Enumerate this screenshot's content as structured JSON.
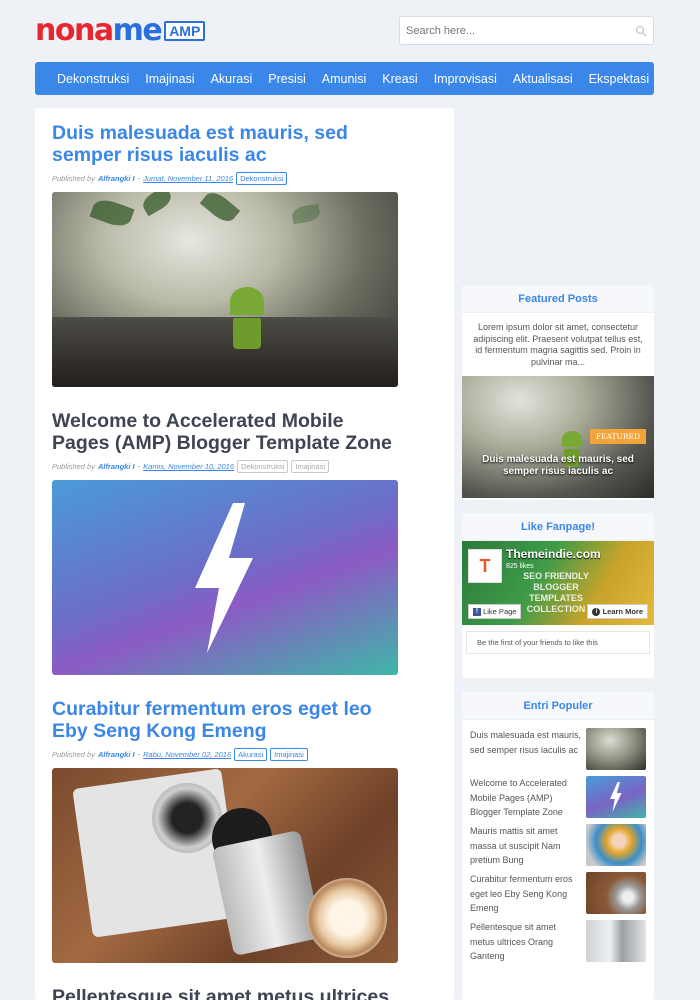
{
  "header": {
    "logo_part1": "nona",
    "logo_part2": "me",
    "logo_badge": "AMP",
    "search_placeholder": "Search here..."
  },
  "nav": {
    "items": [
      "Dekonstruksi",
      "Imajinasi",
      "Akurasi",
      "Presisi",
      "Amunisi",
      "Kreasi",
      "Improvisasi",
      "Aktualisasi",
      "Ekspektasi"
    ]
  },
  "posts": [
    {
      "title": "Duis malesuada est mauris, sed semper risus iaculis ac",
      "published_by": "Published by",
      "author": "Alfrangki I",
      "sep": "-",
      "date": "Jumat, November 11, 2016",
      "labels": [
        "Dekonstruksi"
      ]
    },
    {
      "title": "Welcome to Accelerated Mobile Pages (AMP) Blogger Template Zone",
      "published_by": "Published by",
      "author": "Alfrangki I",
      "sep": "-",
      "date": "Kamis, November 10, 2016",
      "labels": [
        "Dekonstruksi",
        "Imajinasi"
      ]
    },
    {
      "title": "Curabitur fermentum eros eget leo Eby Seng Kong Emeng",
      "published_by": "Published by",
      "author": "Alfrangki I",
      "sep": "-",
      "date": "Rabu, November 02, 2016",
      "labels": [
        "Akurasi",
        "Imajinasi"
      ]
    },
    {
      "title": "Pellentesque sit amet metus ultrices"
    }
  ],
  "sidebar": {
    "featured": {
      "title": "Featured Posts",
      "excerpt": "Lorem ipsum dolor sit amet, consectetur adipiscing elit. Praesent volutpat tellus est, id fermentum magna sagittis sed. Proin in pulvinar ma...",
      "badge": "FEATURED",
      "caption": "Duis malesuada est mauris, sed semper risus iaculis ac"
    },
    "fanpage": {
      "title": "Like Fanpage!",
      "page_name": "Themeindie.com",
      "likes": "825 likes",
      "banner_text": "SEO FRIENDLY BLOGGER TEMPLATES COLLECTION",
      "like_button": "Like Page",
      "learn_button": "Learn More",
      "friends_text": "Be the first of your friends to like this"
    },
    "popular": {
      "title": "Entri Populer",
      "items": [
        "Duis malesuada est mauris, sed semper risus iaculis ac",
        "Welcome to Accelerated Mobile Pages (AMP) Blogger Template Zone",
        "Mauris mattis sit amet massa ut suscipit Nam pretium Bung",
        "Curabitur fermentum eros eget leo Eby Seng Kong Emeng",
        "Pellentesque sit amet metus ultrices Orang Ganteng"
      ]
    }
  },
  "colors": {
    "accent": "#3b86e9",
    "logo_red": "#e8262f",
    "featured_badge": "#f2a43a",
    "background": "#eef1f5"
  }
}
